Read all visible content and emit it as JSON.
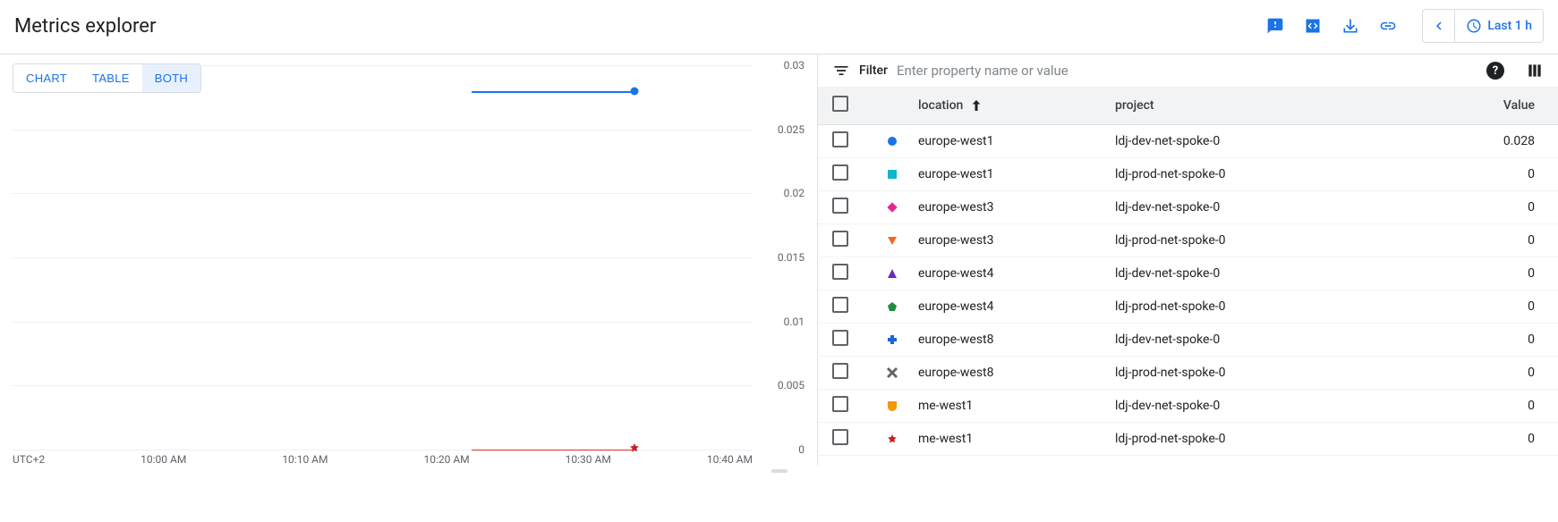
{
  "header": {
    "title": "Metrics explorer",
    "time_range": "Last 1 h"
  },
  "view_tabs": {
    "chart": "CHART",
    "table": "TABLE",
    "both": "BOTH"
  },
  "filter": {
    "label": "Filter",
    "placeholder": "Enter property name or value"
  },
  "table": {
    "headers": {
      "location": "location",
      "project": "project",
      "value": "Value"
    },
    "rows": [
      {
        "marker": "circle",
        "color": "#1a73e8",
        "location": "europe-west1",
        "project": "ldj-dev-net-spoke-0",
        "value": "0.028"
      },
      {
        "marker": "square",
        "color": "#12b5cb",
        "location": "europe-west1",
        "project": "ldj-prod-net-spoke-0",
        "value": "0"
      },
      {
        "marker": "diamond",
        "color": "#e52592",
        "location": "europe-west3",
        "project": "ldj-dev-net-spoke-0",
        "value": "0"
      },
      {
        "marker": "tri-down",
        "color": "#f9651e",
        "location": "europe-west3",
        "project": "ldj-prod-net-spoke-0",
        "value": "0"
      },
      {
        "marker": "tri-up",
        "color": "#7627bb",
        "location": "europe-west4",
        "project": "ldj-dev-net-spoke-0",
        "value": "0"
      },
      {
        "marker": "pentagon",
        "color": "#1e8e3e",
        "location": "europe-west4",
        "project": "ldj-prod-net-spoke-0",
        "value": "0"
      },
      {
        "marker": "plus",
        "color": "#1967d2",
        "location": "europe-west8",
        "project": "ldj-dev-net-spoke-0",
        "value": "0"
      },
      {
        "marker": "x",
        "color": "#5f6368",
        "location": "europe-west8",
        "project": "ldj-prod-net-spoke-0",
        "value": "0"
      },
      {
        "marker": "shield",
        "color": "#f29900",
        "location": "me-west1",
        "project": "ldj-dev-net-spoke-0",
        "value": "0"
      },
      {
        "marker": "star",
        "color": "#c5221f",
        "location": "me-west1",
        "project": "ldj-prod-net-spoke-0",
        "value": "0"
      }
    ]
  },
  "chart_data": {
    "type": "line",
    "xlabel": "UTC+2",
    "x_ticks": [
      "UTC+2",
      "10:00 AM",
      "10:10 AM",
      "10:20 AM",
      "10:30 AM",
      "10:40 AM"
    ],
    "y_ticks": [
      "0",
      "0.005",
      "0.01",
      "0.015",
      "0.02",
      "0.025",
      "0.03"
    ],
    "ylim": [
      0,
      0.03
    ],
    "series": [
      {
        "name": "europe-west1 / ldj-dev-net-spoke-0",
        "color": "#1a73e8",
        "x": [
          "10:22 AM",
          "10:35 AM"
        ],
        "values": [
          0.028,
          0.028
        ]
      },
      {
        "name": "me-west1 / ldj-prod-net-spoke-0",
        "color": "#c5221f",
        "x": [
          "10:22 AM",
          "10:35 AM"
        ],
        "values": [
          0,
          0
        ]
      }
    ]
  }
}
